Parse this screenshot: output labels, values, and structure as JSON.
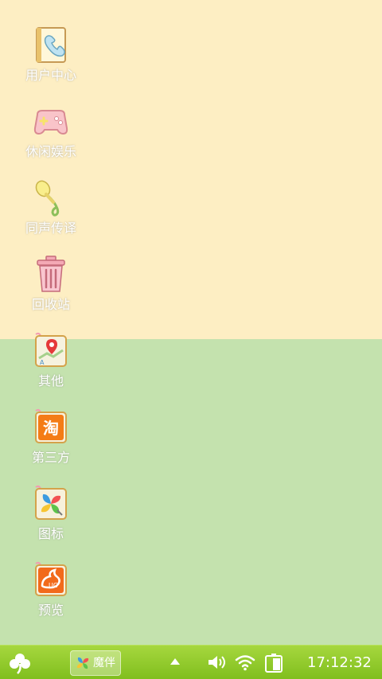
{
  "desktop": {
    "background_top": "#fdeec3",
    "background_bottom": "#c4e2ae",
    "icons": [
      {
        "label": "用户中心",
        "icon": "phone-book-icon"
      },
      {
        "label": "休闲娱乐",
        "icon": "gamepad-icon"
      },
      {
        "label": "同声传译",
        "icon": "translate-icon"
      },
      {
        "label": "回收站",
        "icon": "trash-icon"
      },
      {
        "label": "其他",
        "icon": "map-pin-icon"
      },
      {
        "label": "第三方",
        "icon": "taobao-icon"
      },
      {
        "label": "图标",
        "icon": "pinwheel-icon"
      },
      {
        "label": "预览",
        "icon": "uc-browser-icon"
      }
    ]
  },
  "taskbar": {
    "color": "#8cc628",
    "start_icon": "clover-icon",
    "running_app": {
      "label": "魔伴",
      "icon": "pinwheel-icon"
    },
    "tray": {
      "expand_icon": "triangle-up-icon",
      "volume_icon": "volume-icon",
      "wifi_icon": "wifi-icon",
      "battery_icon": "battery-icon",
      "clock": "17:12:32"
    }
  }
}
